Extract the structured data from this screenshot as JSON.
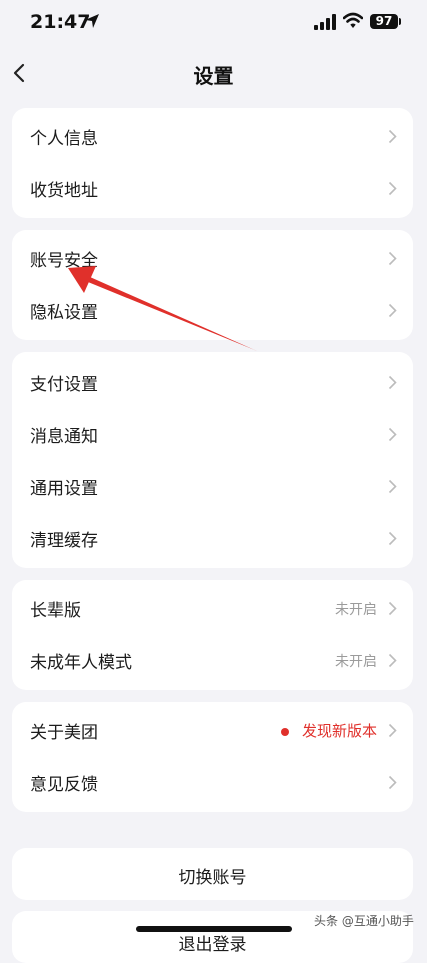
{
  "status_bar": {
    "time": "21:47",
    "battery": "97"
  },
  "nav": {
    "title": "设置"
  },
  "groups": [
    {
      "items": [
        {
          "label": "个人信息"
        },
        {
          "label": "收货地址"
        }
      ]
    },
    {
      "items": [
        {
          "label": "账号安全"
        },
        {
          "label": "隐私设置"
        }
      ]
    },
    {
      "items": [
        {
          "label": "支付设置"
        },
        {
          "label": "消息通知"
        },
        {
          "label": "通用设置"
        },
        {
          "label": "清理缓存"
        }
      ]
    },
    {
      "items": [
        {
          "label": "长辈版",
          "value": "未开启"
        },
        {
          "label": "未成年人模式",
          "value": "未开启"
        }
      ]
    },
    {
      "items": [
        {
          "label": "关于美团",
          "value": "发现新版本"
        },
        {
          "label": "意见反馈"
        }
      ]
    }
  ],
  "buttons": {
    "switch_account": "切换账号",
    "logout": "退出登录"
  },
  "watermark": "头条 @互通小助手",
  "colors": {
    "accent_red": "#e0302b",
    "background": "#f3f3f7"
  },
  "icons": [
    "location-arrow-icon",
    "cellular-signal-icon",
    "wifi-icon",
    "battery-icon",
    "back-chevron-icon",
    "chevron-right-icon"
  ]
}
